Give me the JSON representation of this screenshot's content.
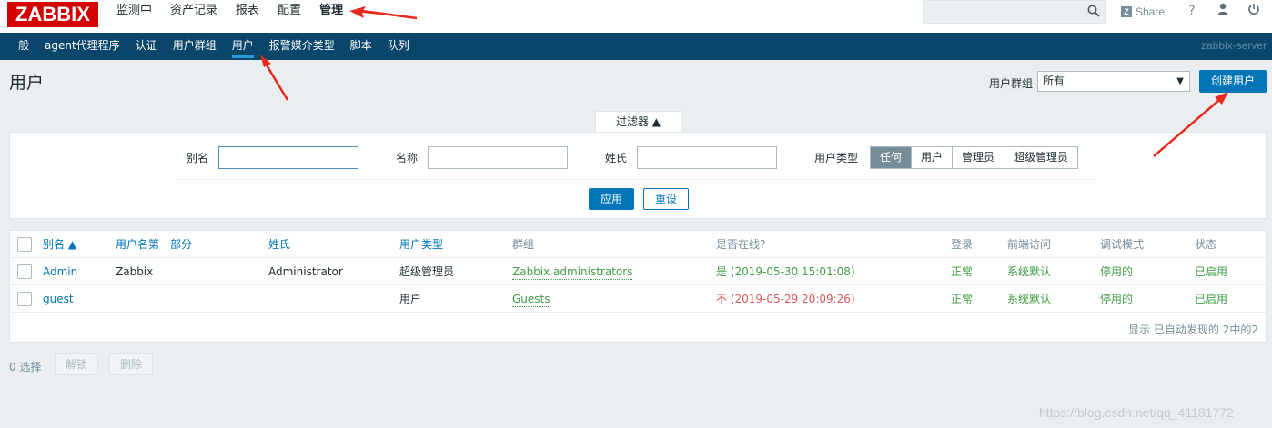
{
  "topbar": {
    "logo": "ZABBIX",
    "menu": [
      "监测中",
      "资产记录",
      "报表",
      "配置",
      "管理"
    ],
    "active_menu": "管理",
    "share_label": "Share",
    "help_glyph": "?",
    "user_glyph": "👤",
    "power_glyph": "⏻",
    "icons": [
      "search-icon",
      "share-icon",
      "help-icon",
      "user-icon",
      "power-icon"
    ]
  },
  "submenu": {
    "items": [
      "一般",
      "agent代理程序",
      "认证",
      "用户群组",
      "用户",
      "报警媒介类型",
      "脚本",
      "队列"
    ],
    "active_item": "用户",
    "server_name": "zabbix-server"
  },
  "header": {
    "title": "用户",
    "group_filter_label": "用户群组",
    "group_filter_value": "所有",
    "create_button": "创建用户"
  },
  "filter": {
    "tab_label": "过滤器 ▲",
    "alias_label": "别名",
    "name_label": "名称",
    "surname_label": "姓氏",
    "user_type_label": "用户类型",
    "user_types": [
      "任何",
      "用户",
      "管理员",
      "超级管理员"
    ],
    "active_user_type": "任何",
    "apply_button": "应用",
    "reset_button": "重设"
  },
  "table": {
    "columns": [
      "别名 ▲",
      "用户名第一部分",
      "姓氏",
      "用户类型",
      "群组",
      "是否在线?",
      "登录",
      "前端访问",
      "调试模式",
      "状态"
    ],
    "rows": [
      {
        "alias": "Admin",
        "name": "Zabbix",
        "surname": "Administrator",
        "type": "超级管理员",
        "group": "Zabbix administrators",
        "online": "是 (2019-05-30 15:01:08)",
        "online_status": "yes",
        "login": "正常",
        "frontend": "系统默认",
        "debug": "停用的",
        "status": "已启用"
      },
      {
        "alias": "guest",
        "name": "",
        "surname": "",
        "type": "用户",
        "group": "Guests",
        "online": "不 (2019-05-29 20:09:26)",
        "online_status": "no",
        "login": "正常",
        "frontend": "系统默认",
        "debug": "停用的",
        "status": "已启用"
      }
    ],
    "footer": "显示 已自动发现的 2中的2"
  },
  "actions": {
    "selected": "0 选择",
    "unblock_button": "解锁",
    "delete_button": "删除"
  },
  "watermark": "https://blog.csdn.net/qq_41181772",
  "colors": {
    "brand_red": "#d40000",
    "submenu_bg": "#0a466a",
    "primary_blue": "#0275b8",
    "success_green": "#429e47",
    "error_red": "#e45959",
    "annotation_arrow": "#e8291c"
  }
}
